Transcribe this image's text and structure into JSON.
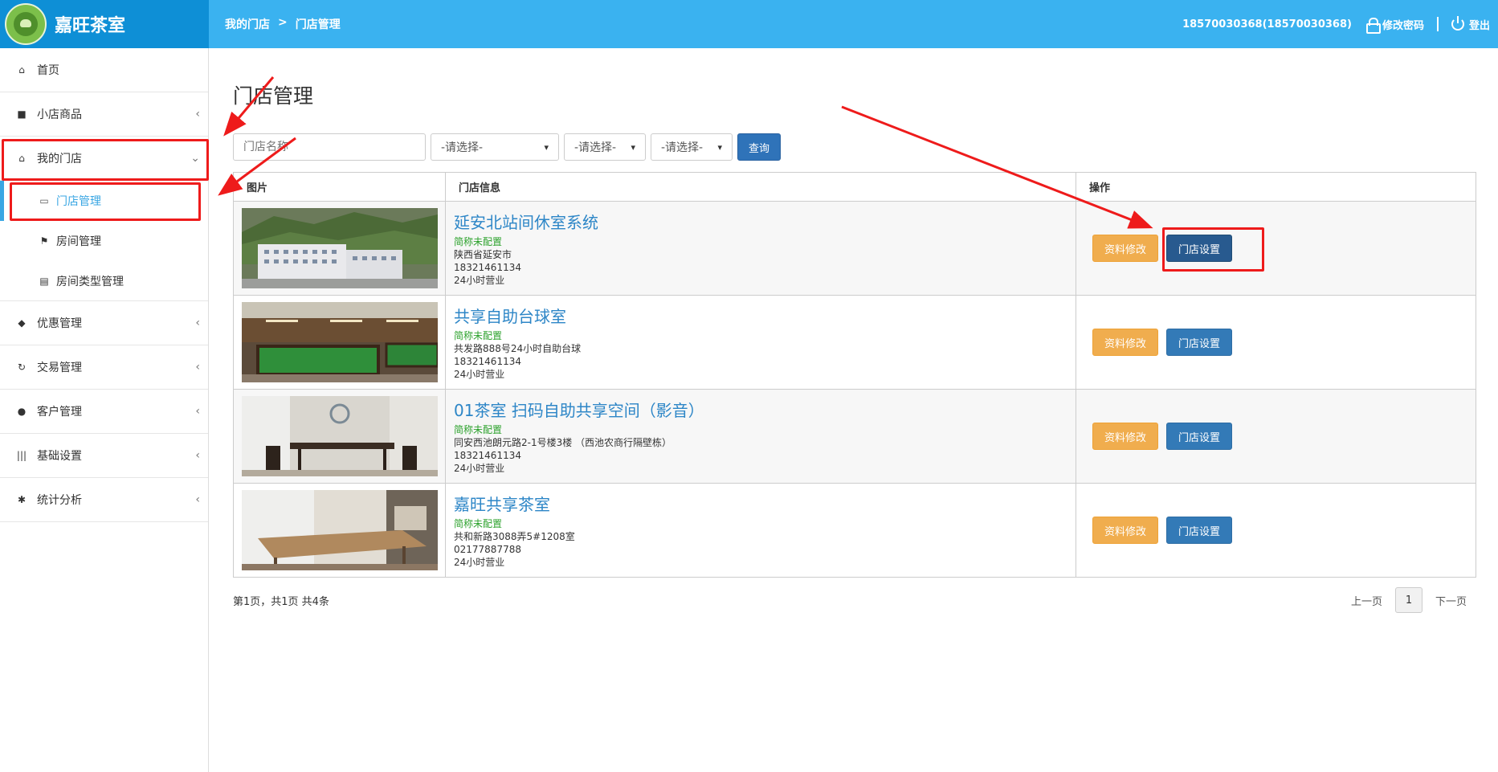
{
  "brand": {
    "name": "嘉旺茶室",
    "logo_text": "嘉旺"
  },
  "breadcrumb": {
    "item1": "我的门店",
    "separator": ">",
    "item2": "门店管理"
  },
  "topbar": {
    "user": "18570030368(18570030368)",
    "change_password": "修改密码",
    "logout": "登出"
  },
  "sidebar": {
    "home": "首页",
    "shop_goods": "小店商品",
    "my_store": "我的门店",
    "store_manage": "门店管理",
    "room_manage": "房间管理",
    "room_type_manage": "房间类型管理",
    "discount_manage": "优惠管理",
    "trade_manage": "交易管理",
    "customer_manage": "客户管理",
    "basic_settings": "基础设置",
    "statistics": "统计分析"
  },
  "main": {
    "title": "门店管理",
    "search_placeholder": "门店名称",
    "select_placeholder": "-请选择-",
    "query_button": "查询",
    "columns": {
      "image": "图片",
      "info": "门店信息",
      "ops": "操作"
    },
    "edit_label": "资料修改",
    "settings_label": "门店设置",
    "stores": [
      {
        "name": "延安北站间休室系统",
        "short": "简称未配置",
        "address": "陕西省延安市",
        "phone": "18321461134",
        "hours": "24小时营业"
      },
      {
        "name": "共享自助台球室",
        "short": "简称未配置",
        "address": "共发路888号24小时自助台球",
        "phone": "18321461134",
        "hours": "24小时营业"
      },
      {
        "name": "01茶室 扫码自助共享空间（影音）",
        "short": "简称未配置",
        "address": "同安西池朗元路2-1号楼3楼 （西池农商行隔壁栋）",
        "phone": "18321461134",
        "hours": "24小时营业"
      },
      {
        "name": "嘉旺共享茶室",
        "short": "简称未配置",
        "address": "共和新路3088弄5#1208室",
        "phone": "02177887788",
        "hours": "24小时营业"
      }
    ],
    "pagination": {
      "info": "第1页，共1页 共4条",
      "prev": "上一页",
      "current": "1",
      "next": "下一页"
    }
  }
}
